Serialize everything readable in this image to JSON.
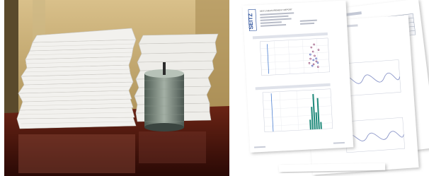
{
  "photo": {
    "description_icon": "paper-stack-icon",
    "colors": {
      "wall": "#c9b07a",
      "wall_dark": "#8a7447",
      "desk": "#5a1f12",
      "desk_dark": "#2e0b06",
      "paper": "#f2f1ee",
      "paper_shadow": "#c9c7c2",
      "cd_spindle": "#6f7f73"
    }
  },
  "documents": {
    "front_page": {
      "logo_text": "SEITZ",
      "header_line": "SEITZ MEASUREMENT REPORT"
    },
    "colors": {
      "page": "#ffffff",
      "shadow": "#bdbdbd",
      "logo": "#2a4f9a",
      "chart_line": "#7c89c8",
      "chart_marker": "#8b3a6a",
      "chart_bar": "#1f8a7a"
    }
  }
}
